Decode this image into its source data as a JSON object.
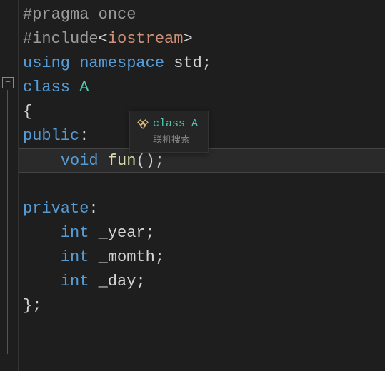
{
  "code": {
    "line1": {
      "pragma": "#pragma",
      "once": "once"
    },
    "line2": {
      "include": "#include",
      "lt": "<",
      "header": "iostream",
      "gt": ">"
    },
    "line3": {
      "using": "using",
      "namespace": "namespace",
      "std": "std",
      "semi": ";"
    },
    "line4": {
      "class": "class",
      "name": "A"
    },
    "line5": {
      "brace": "{"
    },
    "line6": {
      "public": "public",
      "colon": ":"
    },
    "line7": {
      "void": "void",
      "fun": "fun",
      "parens": "()",
      "semi": ";"
    },
    "line8": {
      "blank": ""
    },
    "line9": {
      "private": "private",
      "colon": ":"
    },
    "line10": {
      "int": "int",
      "var": "_year",
      "semi": ";"
    },
    "line11": {
      "int": "int",
      "var": "_momth",
      "semi": ";"
    },
    "line12": {
      "int": "int",
      "var": "_day",
      "semi": ";"
    },
    "line13": {
      "brace": "}",
      "semi": ";"
    }
  },
  "tooltip": {
    "title": "class A",
    "subtitle": "联机搜索"
  },
  "fold": {
    "symbol": "−"
  }
}
